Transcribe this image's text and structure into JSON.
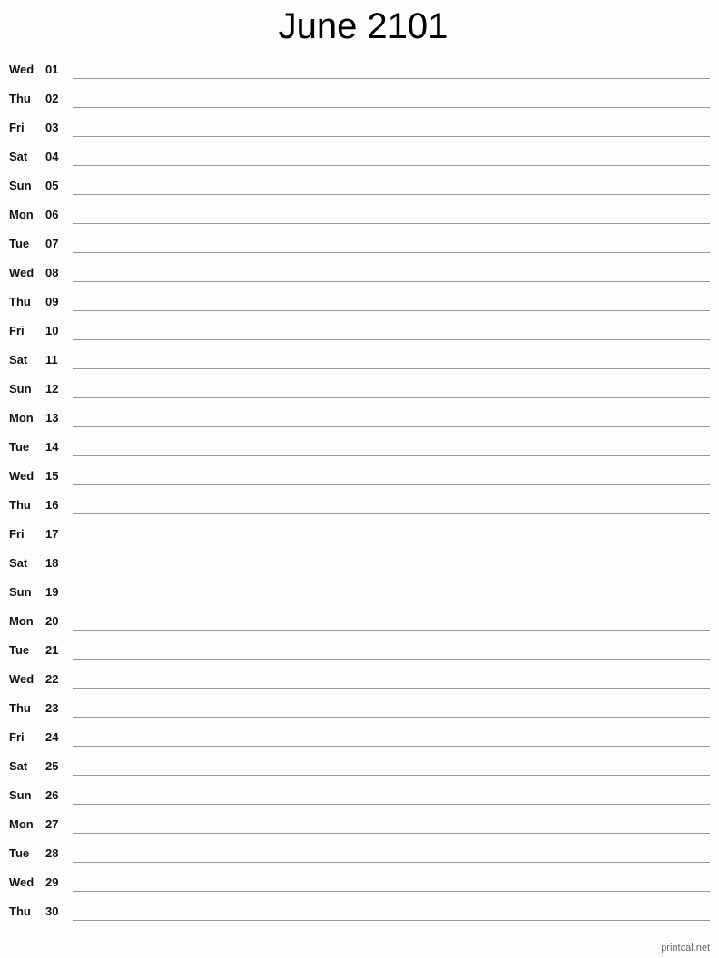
{
  "title": "June 2101",
  "days": [
    {
      "dow": "Wed",
      "day": "01"
    },
    {
      "dow": "Thu",
      "day": "02"
    },
    {
      "dow": "Fri",
      "day": "03"
    },
    {
      "dow": "Sat",
      "day": "04"
    },
    {
      "dow": "Sun",
      "day": "05"
    },
    {
      "dow": "Mon",
      "day": "06"
    },
    {
      "dow": "Tue",
      "day": "07"
    },
    {
      "dow": "Wed",
      "day": "08"
    },
    {
      "dow": "Thu",
      "day": "09"
    },
    {
      "dow": "Fri",
      "day": "10"
    },
    {
      "dow": "Sat",
      "day": "11"
    },
    {
      "dow": "Sun",
      "day": "12"
    },
    {
      "dow": "Mon",
      "day": "13"
    },
    {
      "dow": "Tue",
      "day": "14"
    },
    {
      "dow": "Wed",
      "day": "15"
    },
    {
      "dow": "Thu",
      "day": "16"
    },
    {
      "dow": "Fri",
      "day": "17"
    },
    {
      "dow": "Sat",
      "day": "18"
    },
    {
      "dow": "Sun",
      "day": "19"
    },
    {
      "dow": "Mon",
      "day": "20"
    },
    {
      "dow": "Tue",
      "day": "21"
    },
    {
      "dow": "Wed",
      "day": "22"
    },
    {
      "dow": "Thu",
      "day": "23"
    },
    {
      "dow": "Fri",
      "day": "24"
    },
    {
      "dow": "Sat",
      "day": "25"
    },
    {
      "dow": "Sun",
      "day": "26"
    },
    {
      "dow": "Mon",
      "day": "27"
    },
    {
      "dow": "Tue",
      "day": "28"
    },
    {
      "dow": "Wed",
      "day": "29"
    },
    {
      "dow": "Thu",
      "day": "30"
    }
  ],
  "footer": "printcal.net"
}
